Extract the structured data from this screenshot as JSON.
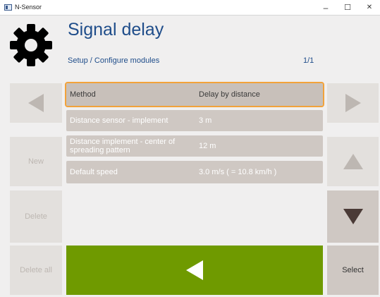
{
  "window": {
    "title": "N-Sensor",
    "minimize": "–",
    "maximize": "☐",
    "close": "✕"
  },
  "header": {
    "title": "Signal delay",
    "breadcrumb": "Setup / Configure modules",
    "pager": "1/1",
    "icon": "gear-icon"
  },
  "left_buttons": {
    "new": "New",
    "delete": "Delete",
    "delete_all": "Delete all"
  },
  "right_buttons": {
    "select": "Select"
  },
  "rows": [
    {
      "label": "Method",
      "value": "Delay by distance"
    },
    {
      "label": "Distance sensor - implement",
      "value": "3 m"
    },
    {
      "label": "Distance implement - center of spreading pattern",
      "value": "12 m"
    },
    {
      "label": "Default speed",
      "value": "3.0 m/s ( = 10.8 km/h )"
    }
  ],
  "colors": {
    "accent_orange": "#f2a23a",
    "title_blue": "#1f4d8a",
    "back_green": "#6f9a00",
    "button_gray": "#cfc8c3"
  }
}
